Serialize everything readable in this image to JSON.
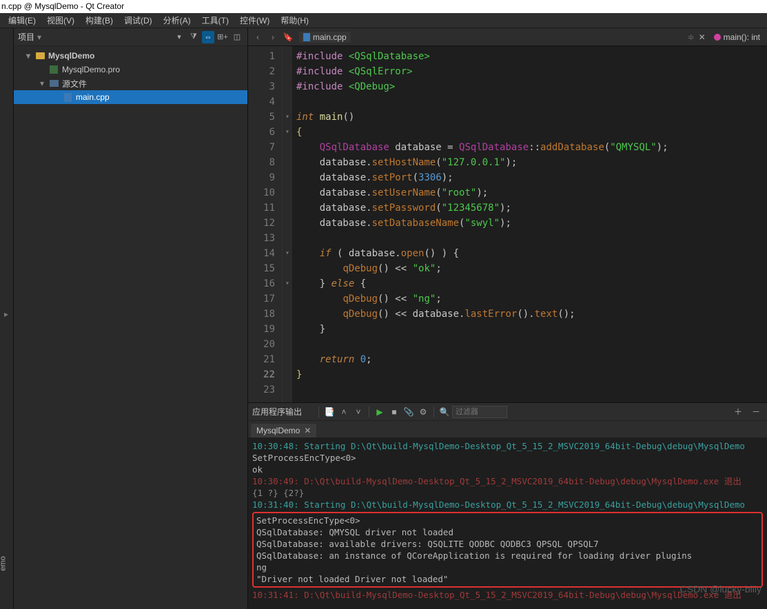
{
  "title_bar": "n.cpp @ MysqlDemo - Qt Creator",
  "menu": {
    "edit": "编辑(E)",
    "view": "视图(V)",
    "build": "构建(B)",
    "debug": "调试(D)",
    "analyze": "分析(A)",
    "tools": "工具(T)",
    "widgets": "控件(W)",
    "help": "帮助(H)"
  },
  "project_panel": {
    "title": "项目",
    "tree": {
      "root": "MysqlDemo",
      "pro": "MysqlDemo.pro",
      "sources": "源文件",
      "main": "main.cpp"
    }
  },
  "editor": {
    "file": "main.cpp",
    "breadcrumb": "main(): int",
    "lines": [
      "1",
      "2",
      "3",
      "4",
      "5",
      "6",
      "7",
      "8",
      "9",
      "10",
      "11",
      "12",
      "13",
      "14",
      "15",
      "16",
      "17",
      "18",
      "19",
      "20",
      "21",
      "22",
      "23"
    ]
  },
  "code": {
    "l1": {
      "a": "#include ",
      "b": "<QSqlDatabase>"
    },
    "l2": {
      "a": "#include ",
      "b": "<QSqlError>"
    },
    "l3": {
      "a": "#include ",
      "b": "<QDebug>"
    },
    "l5": {
      "a": "int",
      "b": " main",
      "c": "()"
    },
    "l6": "{",
    "l7": {
      "a": "    ",
      "b": "QSqlDatabase",
      "c": " database ",
      "d": "=",
      "e": " QSqlDatabase",
      "f": "::",
      "g": "addDatabase",
      "h": "(",
      "i": "\"QMYSQL\"",
      "j": ");"
    },
    "l8": {
      "a": "    database.",
      "b": "setHostName",
      "c": "(",
      "d": "\"127.0.0.1\"",
      "e": ");"
    },
    "l9": {
      "a": "    database.",
      "b": "setPort",
      "c": "(",
      "d": "3306",
      "e": ");"
    },
    "l10": {
      "a": "    database.",
      "b": "setUserName",
      "c": "(",
      "d": "\"root\"",
      "e": ");"
    },
    "l11": {
      "a": "    database.",
      "b": "setPassword",
      "c": "(",
      "d": "\"12345678\"",
      "e": ");"
    },
    "l12": {
      "a": "    database.",
      "b": "setDatabaseName",
      "c": "(",
      "d": "\"swyl\"",
      "e": ");"
    },
    "l14": {
      "a": "    ",
      "b": "if",
      "c": " ( database.",
      "d": "open",
      "e": "() ) {"
    },
    "l15": {
      "a": "        ",
      "b": "qDebug",
      "c": "() << ",
      "d": "\"ok\"",
      "e": ";"
    },
    "l16": {
      "a": "    } ",
      "b": "else",
      "c": " {"
    },
    "l17": {
      "a": "        ",
      "b": "qDebug",
      "c": "() << ",
      "d": "\"ng\"",
      "e": ";"
    },
    "l18": {
      "a": "        ",
      "b": "qDebug",
      "c": "() << database.",
      "d": "lastError",
      "e": "().",
      "f": "text",
      "g": "();"
    },
    "l19": "    }",
    "l21": {
      "a": "    ",
      "b": "return",
      "c": " ",
      "d": "0",
      "e": ";"
    },
    "l22": "}"
  },
  "output": {
    "panel_title": "应用程序输出",
    "tab": "MysqlDemo",
    "search_placeholder": "过滤器",
    "lines": [
      {
        "cls": "out-start",
        "t": "10:30:48: Starting D:\\Qt\\build-MysqlDemo-Desktop_Qt_5_15_2_MSVC2019_64bit-Debug\\debug\\MysqlDemo"
      },
      {
        "cls": "out-app",
        "t": "SetProcessEncType<0>"
      },
      {
        "cls": "out-app",
        "t": "ok"
      },
      {
        "cls": "out-exit",
        "t": "10:30:49: D:\\Qt\\build-MysqlDemo-Desktop_Qt_5_15_2_MSVC2019_64bit-Debug\\debug\\MysqlDemo.exe 退出"
      },
      {
        "cls": "out-norm",
        "t": "  {1 ?} {2?}"
      },
      {
        "cls": "out-norm",
        "t": ""
      },
      {
        "cls": "out-start",
        "t": "10:31:40: Starting D:\\Qt\\build-MysqlDemo-Desktop_Qt_5_15_2_MSVC2019_64bit-Debug\\debug\\MysqlDemo"
      }
    ],
    "err_lines": [
      "SetProcessEncType<0>",
      "QSqlDatabase: QMYSQL driver not loaded",
      "QSqlDatabase: available drivers: QSQLITE QODBC QODBC3 QPSQL QPSQL7",
      "QSqlDatabase: an instance of QCoreApplication is required for loading driver plugins",
      "ng",
      "\"Driver not loaded Driver not loaded\""
    ],
    "after_err": {
      "cls": "out-exit",
      "t": "10:31:41: D:\\Qt\\build-MysqlDemo-Desktop_Qt_5_15_2_MSVC2019_64bit-Debug\\debug\\MysqlDemo.exe 退出"
    }
  },
  "watermark": "CSDN @lucky-billy",
  "left_strip_label": "emo"
}
